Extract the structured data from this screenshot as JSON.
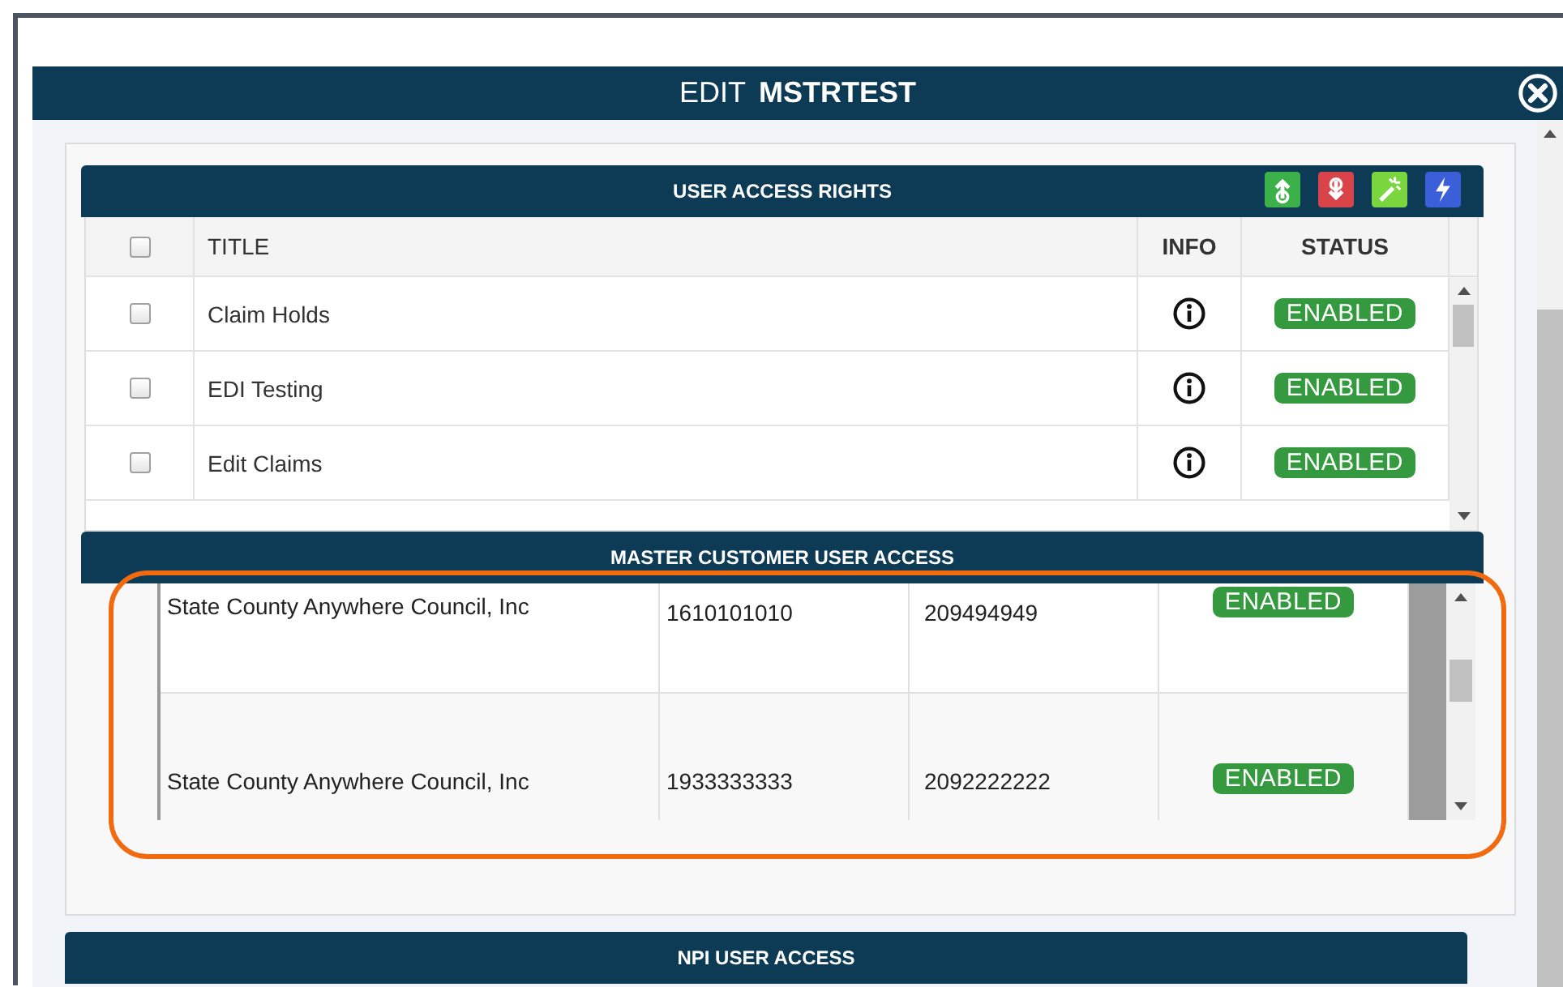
{
  "modal": {
    "title_prefix": "EDIT",
    "title": "MSTRTEST"
  },
  "user_access_rights": {
    "title": "USER ACCESS RIGHTS",
    "columns": [
      "TITLE",
      "INFO",
      "STATUS"
    ],
    "select_all": {
      "checked": false
    },
    "rows": [
      {
        "title": "Claim Holds",
        "checked": false,
        "status": "ENABLED"
      },
      {
        "title": "EDI Testing",
        "checked": false,
        "status": "ENABLED"
      },
      {
        "title": "Edit Claims",
        "checked": false,
        "status": "ENABLED"
      }
    ]
  },
  "master_customer_user_access": {
    "title": "MASTER CUSTOMER USER ACCESS",
    "highlighted": true,
    "rows": [
      {
        "column_1": "State County Anywhere Council, Inc",
        "column_2": "1610101010",
        "column_3": "209494949",
        "status": "ENABLED"
      },
      {
        "column_1": "State County Anywhere Council, Inc",
        "column_2": "1933333333",
        "column_3": "2092222222",
        "status": "ENABLED"
      }
    ]
  },
  "npi_user_access": {
    "title": "NPI USER ACCESS"
  }
}
